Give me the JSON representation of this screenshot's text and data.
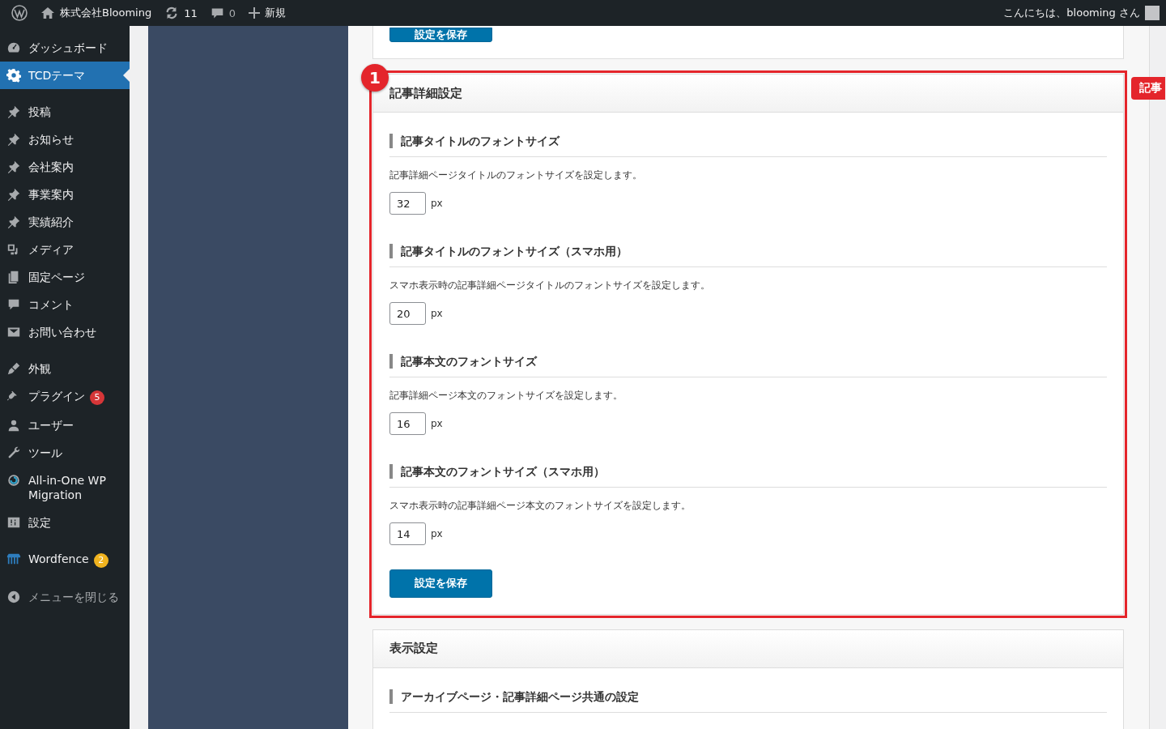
{
  "admin_bar": {
    "site_name": "株式会社Blooming",
    "updates": "11",
    "comments": "0",
    "new_label": "新規",
    "greeting": "こんにちは、blooming さん"
  },
  "sidebar": {
    "groups": [
      [
        {
          "label": "ダッシュボード",
          "selected": false
        },
        {
          "label": "TCDテーマ",
          "selected": true
        }
      ],
      [
        {
          "label": "投稿",
          "selected": false
        },
        {
          "label": "お知らせ",
          "selected": false
        },
        {
          "label": "会社案内",
          "selected": false
        },
        {
          "label": "事業案内",
          "selected": false
        },
        {
          "label": "実績紹介",
          "selected": false
        },
        {
          "label": "メディア",
          "selected": false
        },
        {
          "label": "固定ページ",
          "selected": false
        },
        {
          "label": "コメント",
          "selected": false
        },
        {
          "label": "お問い合わせ",
          "selected": false
        }
      ],
      [
        {
          "label": "外観",
          "selected": false
        },
        {
          "label": "プラグイン",
          "selected": false,
          "badge": "5",
          "color": "#d63638"
        },
        {
          "label": "ユーザー",
          "selected": false
        },
        {
          "label": "ツール",
          "selected": false
        },
        {
          "label": "All-in-One WP Migration",
          "selected": false
        },
        {
          "label": "設定",
          "selected": false
        }
      ],
      [
        {
          "label": "Wordfence",
          "selected": false,
          "badge": "2",
          "color": "#f0b31f"
        }
      ]
    ],
    "collapse_label": "メニューを閉じる"
  },
  "top_save_button": "設定を保存",
  "sections": [
    {
      "title": "記事詳細設定",
      "marker": "1",
      "side_tab": "記事",
      "fields": [
        {
          "heading": "記事タイトルのフォントサイズ",
          "description": "記事詳細ページタイトルのフォントサイズを設定します。",
          "value": "32",
          "unit": "px"
        },
        {
          "heading": "記事タイトルのフォントサイズ（スマホ用）",
          "description": "スマホ表示時の記事詳細ページタイトルのフォントサイズを設定します。",
          "value": "20",
          "unit": "px"
        },
        {
          "heading": "記事本文のフォントサイズ",
          "description": "記事詳細ページ本文のフォントサイズを設定します。",
          "value": "16",
          "unit": "px"
        },
        {
          "heading": "記事本文のフォントサイズ（スマホ用）",
          "description": "スマホ表示時の記事詳細ページ本文のフォントサイズを設定します。",
          "value": "14",
          "unit": "px"
        }
      ],
      "save_button": "設定を保存"
    },
    {
      "title": "表示設定",
      "fields": [
        {
          "heading": "アーカイブページ・記事詳細ページ共通の設定"
        }
      ]
    }
  ]
}
